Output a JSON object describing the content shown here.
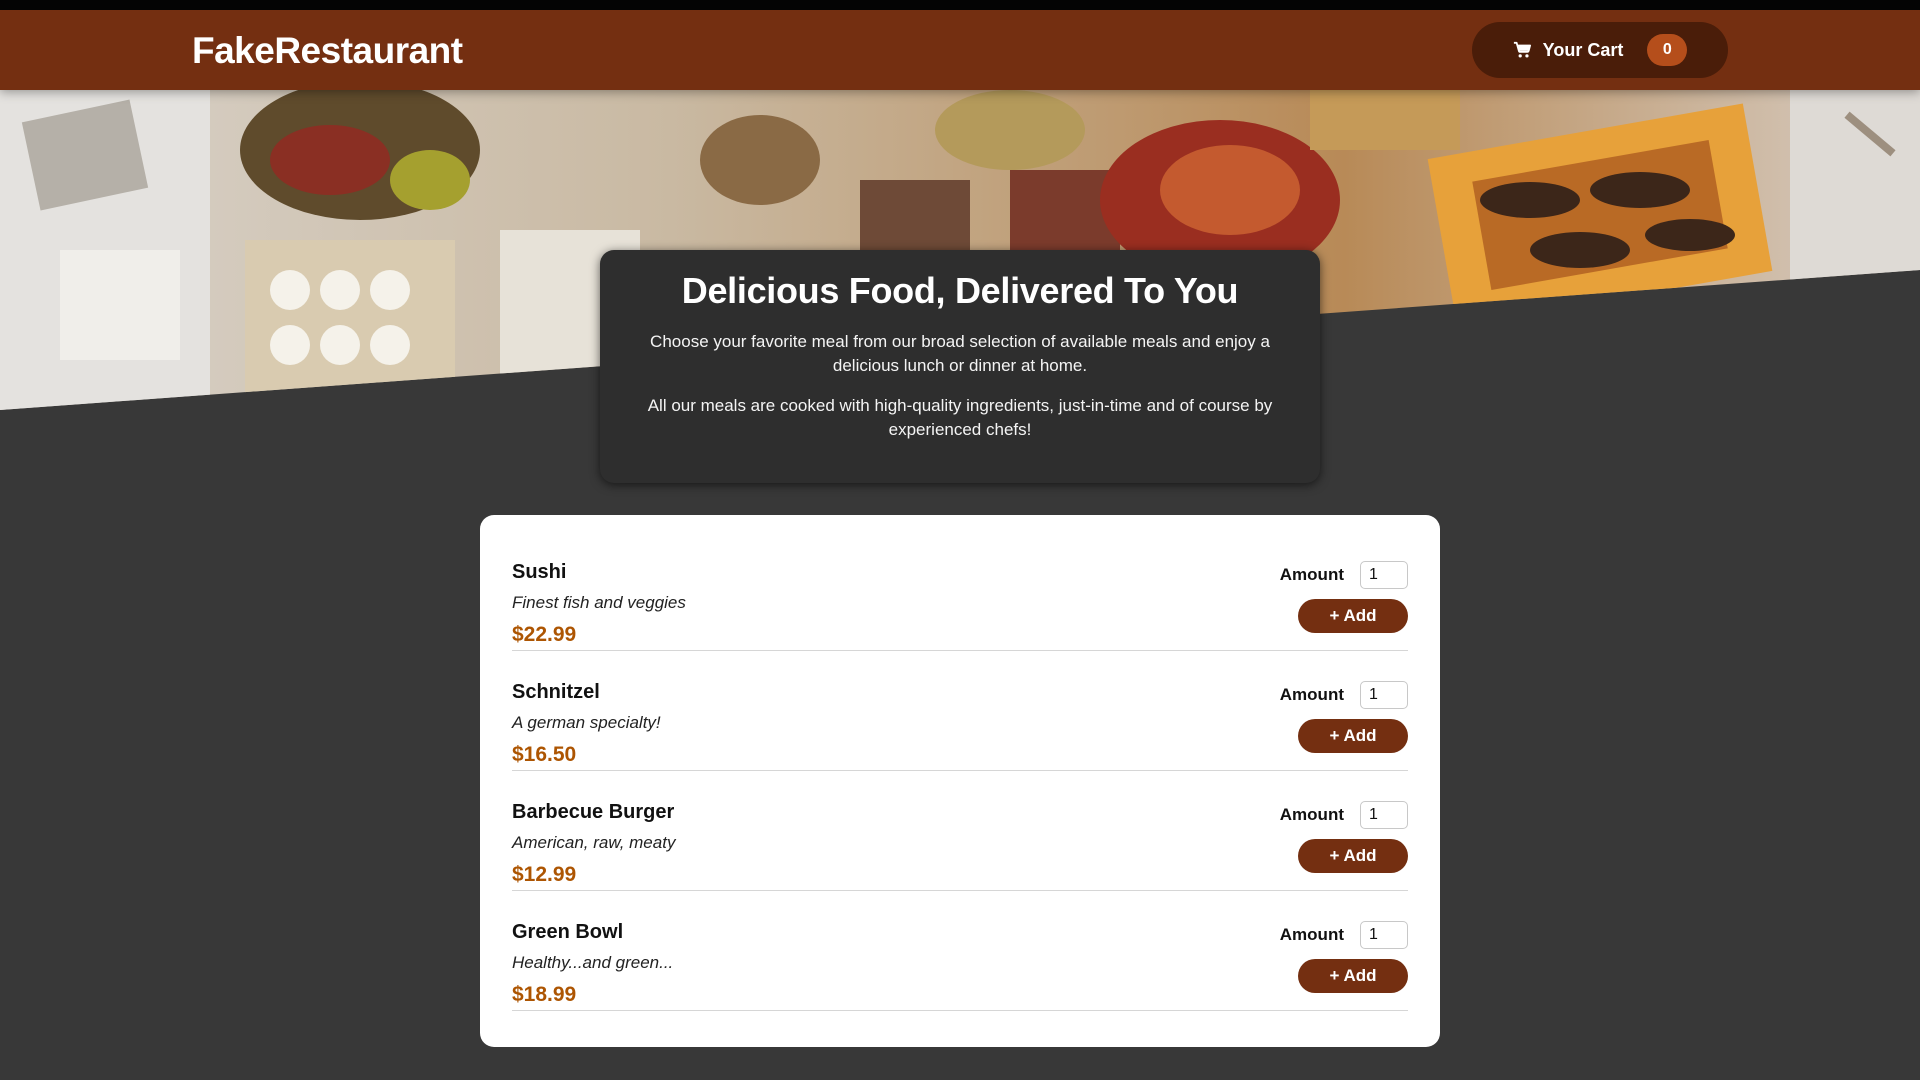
{
  "header": {
    "brand": "FakeRestaurant",
    "cart_label": "Your Cart",
    "cart_count": "0"
  },
  "summary": {
    "title": "Delicious Food, Delivered To You",
    "paragraph1": "Choose your favorite meal from our broad selection of available meals and enjoy a delicious lunch or dinner at home.",
    "paragraph2": "All our meals are cooked with high-quality ingredients, just-in-time and of course by experienced chefs!"
  },
  "meals": [
    {
      "name": "Sushi",
      "description": "Finest fish and veggies",
      "price": "$22.99",
      "amount_label": "Amount",
      "amount": "1",
      "add_label": "+ Add"
    },
    {
      "name": "Schnitzel",
      "description": "A german specialty!",
      "price": "$16.50",
      "amount_label": "Amount",
      "amount": "1",
      "add_label": "+ Add"
    },
    {
      "name": "Barbecue Burger",
      "description": "American, raw, meaty",
      "price": "$12.99",
      "amount_label": "Amount",
      "amount": "1",
      "add_label": "+ Add"
    },
    {
      "name": "Green Bowl",
      "description": "Healthy...and green...",
      "price": "$18.99",
      "amount_label": "Amount",
      "amount": "1",
      "add_label": "+ Add"
    }
  ],
  "colors": {
    "header_bg": "#742f11",
    "cart_bg": "#4a1d09",
    "badge_bg": "#b54e1b",
    "price": "#ad5502",
    "page_bg": "#383838"
  },
  "icons": {
    "cart": "shopping-cart-icon"
  }
}
